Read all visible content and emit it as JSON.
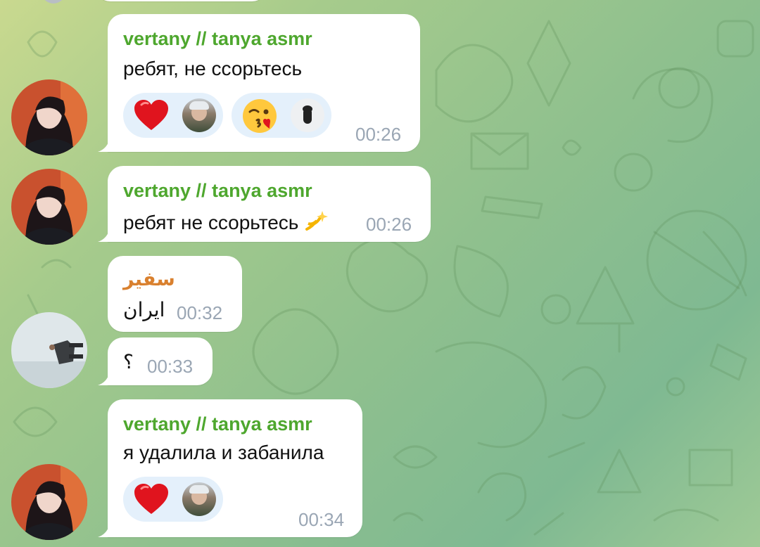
{
  "messages": [
    {
      "sender": "vertany // tanya asmr",
      "text": "ребят, не ссорьтесь",
      "time": "00:26",
      "reactions": [
        {
          "emoji": "heart",
          "icon": "red-heart-icon"
        },
        {
          "emoji": "kissing-face-with-heart",
          "icon": "kiss-face-icon"
        }
      ]
    },
    {
      "sender": "vertany // tanya asmr",
      "text": "ребят не ссорьтесь",
      "emoji": "dizzy",
      "time": "00:26"
    },
    {
      "sender": "سفير",
      "text": "ايران",
      "time": "00:32"
    },
    {
      "text": "؟",
      "time": "00:33"
    },
    {
      "sender": "vertany // tanya asmr",
      "text": "я удалила и забанила",
      "time": "00:34",
      "reactions": [
        {
          "emoji": "heart",
          "icon": "red-heart-icon"
        }
      ]
    }
  ],
  "colors": {
    "sender_green": "#4ea72e",
    "sender_orange": "#d9802e",
    "time_gray": "#9aa6b4",
    "reaction_bg": "#e4f0fb",
    "bubble_bg": "#ffffff"
  }
}
